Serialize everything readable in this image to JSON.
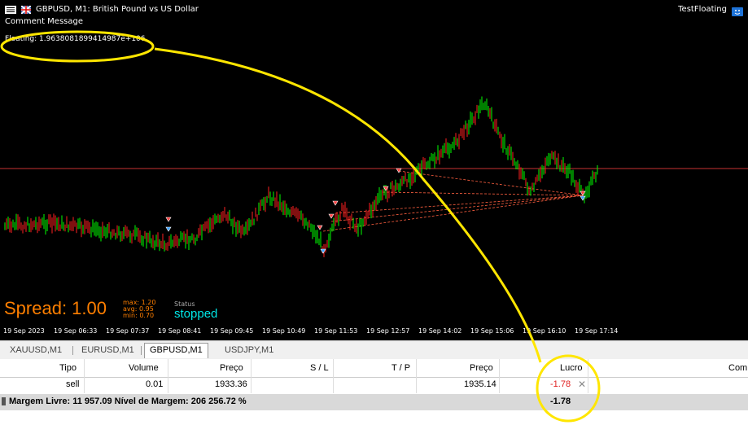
{
  "chart": {
    "menu_icon": "menu-icon",
    "flag_icon": "flag-icon",
    "title": "GBPUSD, M1:  British Pound vs US Dollar",
    "expert_name": "TestFloating",
    "expert_icon": "expert-smiley-icon",
    "comment_title": "Comment Message",
    "comment_value": "Floating: 1.9638081899414987e+106",
    "spread_text": "Spread: 1.00",
    "spread_stats": [
      {
        "key": "max:",
        "value": "1.20"
      },
      {
        "key": "avg:",
        "value": "0.95"
      },
      {
        "key": "min:",
        "value": "0.70"
      }
    ],
    "status_label": "Status",
    "status_value": "stopped",
    "time_labels": [
      "19 Sep 2023",
      "19 Sep 06:33",
      "19 Sep 07:37",
      "19 Sep 08:41",
      "19 Sep 09:45",
      "19 Sep 10:49",
      "19 Sep 11:53",
      "19 Sep 12:57",
      "19 Sep 14:02",
      "19 Sep 15:06",
      "19 Sep 16:10",
      "19 Sep 17:14"
    ],
    "colors": {
      "bull": "#00ff00",
      "bear": "#ff2020",
      "price_line": "#c83232",
      "trade_line": "#ff6040",
      "annotation": "#ffe600"
    }
  },
  "tabs": [
    "XAUUSD,M1",
    "EURUSD,M1",
    "GBPUSD,M1",
    "USDJPY,M1"
  ],
  "active_tab": "GBPUSD,M1",
  "table": {
    "headers": {
      "tipo": "Tipo",
      "volume": "Volume",
      "preco": "Preço",
      "sl": "S / L",
      "tp": "T / P",
      "preco2": "Preço",
      "lucro": "Lucro",
      "com": "Com"
    },
    "row": {
      "tipo": "sell",
      "volume": "0.01",
      "preco": "1933.36",
      "preco2": "1935.14",
      "lucro": "-1.78",
      "close_icon": "close-icon"
    },
    "footer": {
      "text": "Margem Livre: 11 957.09  Nível de Margem: 206 256.72 %",
      "total": "-1.78"
    }
  }
}
